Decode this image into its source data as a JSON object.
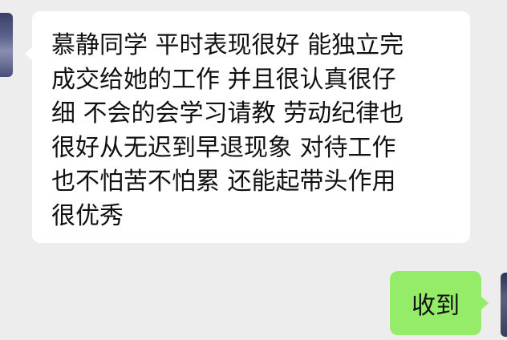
{
  "chat": {
    "incoming_message": {
      "lines": [
        "慕静同学 平时表现很好 能独立完",
        "成交给她的工作 并且很认真很仔",
        "细 不会的会学习请教 劳动纪律也",
        "很好从无迟到早退现象 对待工作",
        "也不怕苦不怕累 还能起带头作用",
        "很优秀"
      ]
    },
    "outgoing_message": {
      "text": "收到"
    }
  },
  "colors": {
    "background": "#ededed",
    "incoming_bubble": "#ffffff",
    "outgoing_bubble": "#95ec69"
  }
}
